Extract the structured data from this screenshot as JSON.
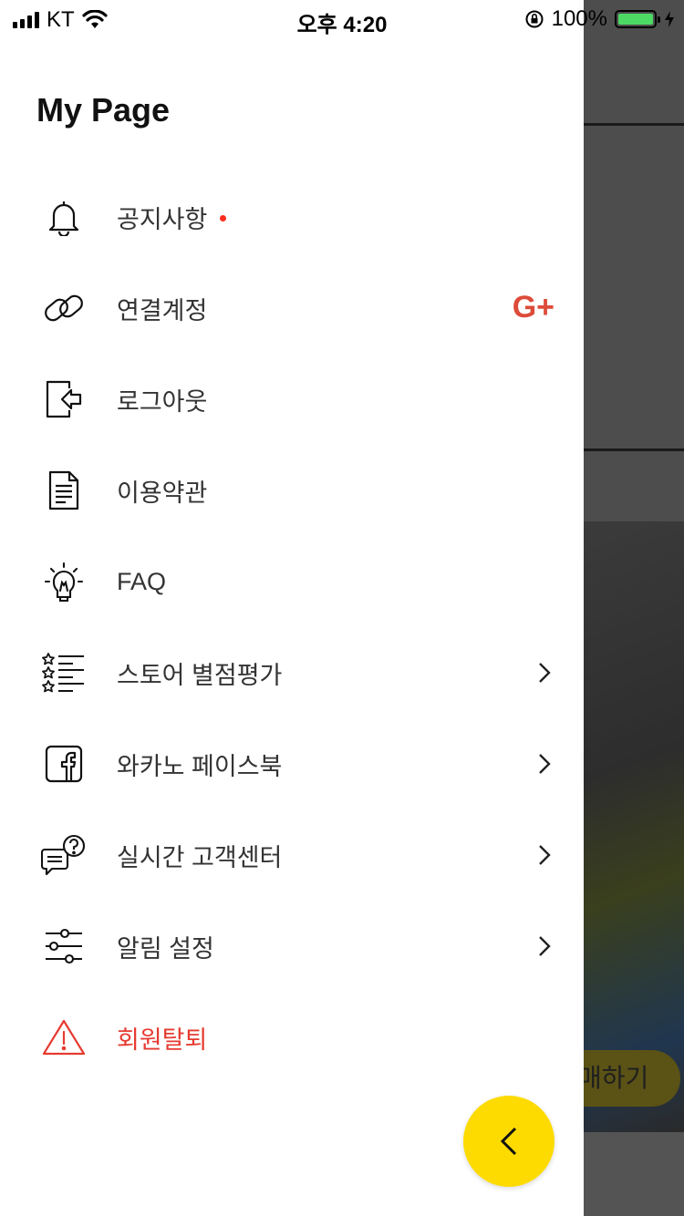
{
  "status_bar": {
    "carrier": "KT",
    "time": "오후 4:20",
    "battery": "100%"
  },
  "drawer": {
    "title": "My Page",
    "items": [
      {
        "label": "공지사항",
        "icon": "bell-icon",
        "badge": true
      },
      {
        "label": "연결계정",
        "icon": "link-icon",
        "account": "G+"
      },
      {
        "label": "로그아웃",
        "icon": "logout-icon"
      },
      {
        "label": "이용약관",
        "icon": "document-icon"
      },
      {
        "label": "FAQ",
        "icon": "lightbulb-icon"
      },
      {
        "label": "스토어 별점평가",
        "icon": "star-list-icon",
        "chevron": true
      },
      {
        "label": "와카노 페이스북",
        "icon": "facebook-icon",
        "chevron": true
      },
      {
        "label": "실시간 고객센터",
        "icon": "chat-help-icon",
        "chevron": true
      },
      {
        "label": "알림 설정",
        "icon": "sliders-icon",
        "chevron": true
      },
      {
        "label": "회원탈퇴",
        "icon": "warning-icon",
        "danger": true
      }
    ]
  },
  "background": {
    "button_label": "매하기"
  },
  "colors": {
    "accent": "#fedb00",
    "danger": "#e63b30",
    "google": "#dd4b39",
    "badge": "#ff2d1f"
  }
}
